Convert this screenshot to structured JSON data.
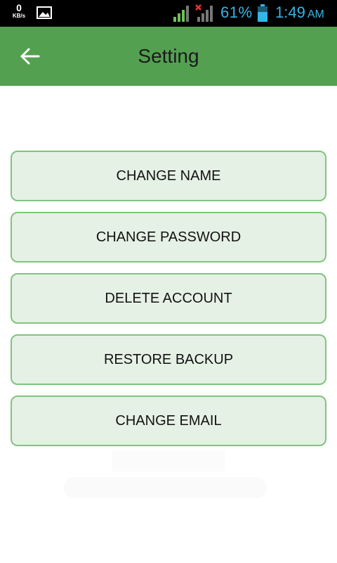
{
  "status_bar": {
    "net_speed": "0",
    "net_unit": "KB/s",
    "battery_percent": "61%",
    "time": "1:49",
    "ampm": "AM",
    "accent_color": "#35b5e5"
  },
  "app_bar": {
    "title": "Setting",
    "back_icon": "arrow-left-icon",
    "color": "#53a150"
  },
  "settings": {
    "buttons": [
      {
        "label": "CHANGE NAME"
      },
      {
        "label": "CHANGE PASSWORD"
      },
      {
        "label": "DELETE ACCOUNT"
      },
      {
        "label": "RESTORE BACKUP"
      },
      {
        "label": "CHANGE EMAIL"
      }
    ]
  }
}
